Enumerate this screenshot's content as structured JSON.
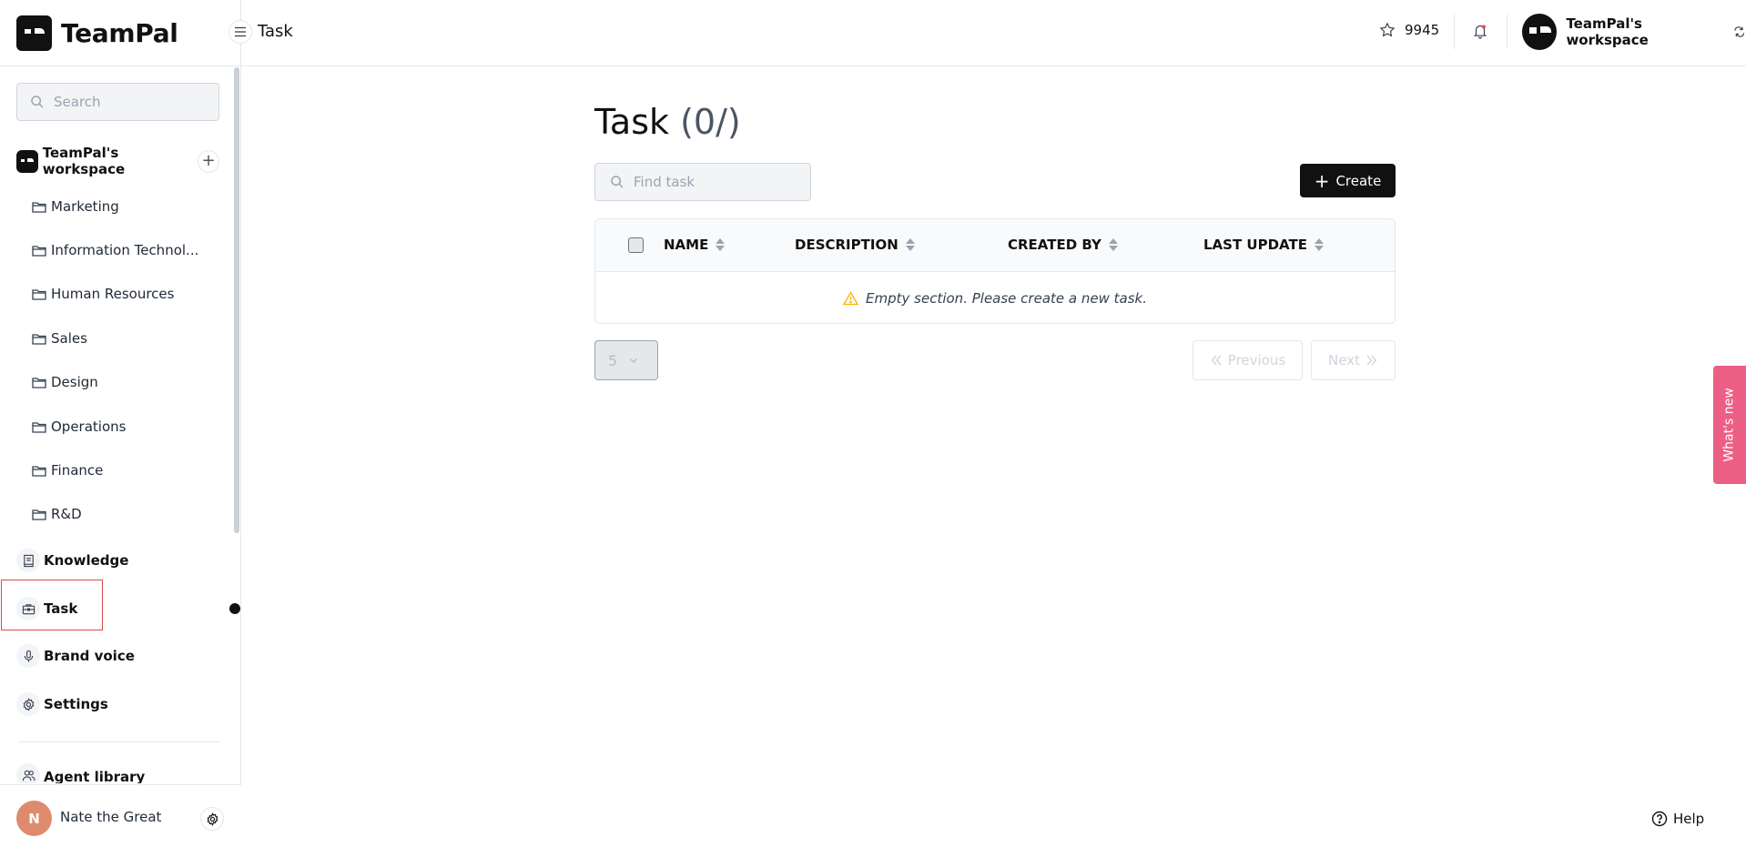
{
  "brand": {
    "name": "TeamPal"
  },
  "header": {
    "title": "Task",
    "stars": "9945",
    "workspace": "TeamPal's workspace"
  },
  "sidebar": {
    "search_placeholder": "Search",
    "workspace": {
      "name": "TeamPal's workspace"
    },
    "folders": [
      {
        "label": "Marketing"
      },
      {
        "label": "Information Technol..."
      },
      {
        "label": "Human Resources"
      },
      {
        "label": "Sales"
      },
      {
        "label": "Design"
      },
      {
        "label": "Operations"
      },
      {
        "label": "Finance"
      },
      {
        "label": "R&D"
      }
    ],
    "nav": [
      {
        "label": "Knowledge",
        "icon": "book-icon"
      },
      {
        "label": "Task",
        "icon": "briefcase-icon",
        "active": true
      },
      {
        "label": "Brand voice",
        "icon": "microphone-icon"
      },
      {
        "label": "Settings",
        "icon": "gear-icon"
      },
      {
        "label": "Agent library",
        "icon": "users-icon"
      }
    ],
    "user": {
      "initial": "N",
      "name": "Nate the Great"
    }
  },
  "main": {
    "title": "Task",
    "count": "(0/)",
    "search_placeholder": "Find task",
    "create_label": "Create",
    "table": {
      "columns": [
        "NAME",
        "DESCRIPTION",
        "CREATED BY",
        "LAST UPDATE"
      ],
      "rows": [],
      "empty_message": "Empty section. Please create a new task."
    },
    "pagination": {
      "page_size": "5",
      "previous_label": "Previous",
      "next_label": "Next"
    }
  },
  "widgets": {
    "whats_new": "What's new",
    "help": "Help"
  },
  "colors": {
    "accent": "#111111",
    "whats_new_bg": "#ec5f85",
    "avatar_bg": "#de8a6f",
    "highlight_border": "#dc4b4b",
    "warning": "#f5b301"
  }
}
